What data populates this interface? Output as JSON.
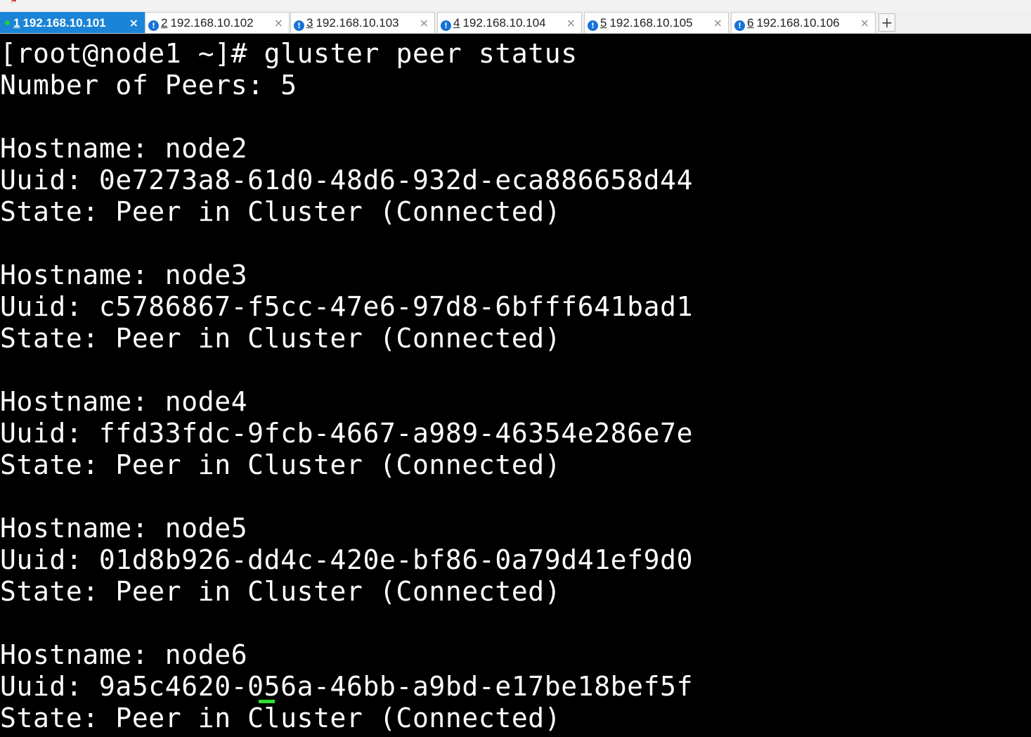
{
  "window": {
    "new_tab_label": "+",
    "tabs": [
      {
        "number": "1",
        "host": "192.168.10.101",
        "active": true,
        "close": "×"
      },
      {
        "number": "2",
        "host": "192.168.10.102",
        "active": false,
        "close": "×"
      },
      {
        "number": "3",
        "host": "192.168.10.103",
        "active": false,
        "close": "×"
      },
      {
        "number": "4",
        "host": "192.168.10.104",
        "active": false,
        "close": "×"
      },
      {
        "number": "5",
        "host": "192.168.10.105",
        "active": false,
        "close": "×"
      },
      {
        "number": "6",
        "host": "192.168.10.106",
        "active": false,
        "close": "×"
      }
    ]
  },
  "terminal": {
    "prompt": "[root@node1 ~]#",
    "command": "gluster peer status",
    "peer_count_line": "Number of Peers: 5",
    "peers": [
      {
        "hostname": "Hostname: node2",
        "uuid": "Uuid: 0e7273a8-61d0-48d6-932d-eca886658d44",
        "state": "State: Peer in Cluster (Connected)"
      },
      {
        "hostname": "Hostname: node3",
        "uuid": "Uuid: c5786867-f5cc-47e6-97d8-6bfff641bad1",
        "state": "State: Peer in Cluster (Connected)"
      },
      {
        "hostname": "Hostname: node4",
        "uuid": "Uuid: ffd33fdc-9fcb-4667-a989-46354e286e7e",
        "state": "State: Peer in Cluster (Connected)"
      },
      {
        "hostname": "Hostname: node5",
        "uuid": "Uuid: 01d8b926-dd4c-420e-bf86-0a79d41ef9d0",
        "state": "State: Peer in Cluster (Connected)"
      },
      {
        "hostname": "Hostname: node6",
        "uuid": "Uuid: 9a5c4620-056a-46bb-a9bd-e17be18bef5f",
        "state": "State: Peer in Cluster (Connected)"
      }
    ]
  },
  "colors": {
    "active_tab": "#1b84d6",
    "terminal_bg": "#000000",
    "terminal_fg": "#ffffff",
    "cursor": "#2fe02f",
    "status_connected": "#22cc44",
    "status_info": "#1572d6"
  }
}
